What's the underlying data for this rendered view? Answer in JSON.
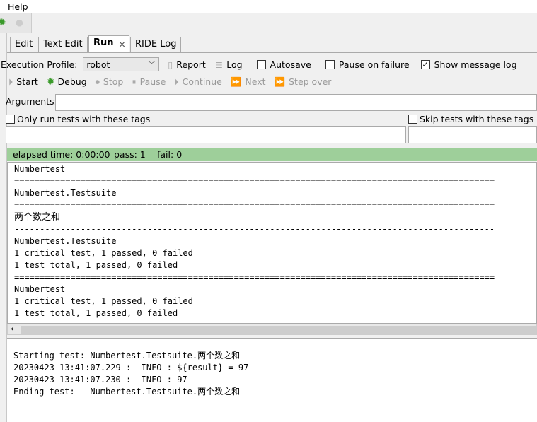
{
  "menu": {
    "help": "Help"
  },
  "tabs": [
    "Edit",
    "Text Edit",
    "Run",
    "RIDE Log"
  ],
  "tab_close": "×",
  "profile": {
    "label": "Execution Profile:",
    "value": "robot",
    "report": "Report",
    "log": "Log",
    "autosave": "Autosave",
    "pause_on_failure": "Pause on failure",
    "show_message_log": "Show message log",
    "autosave_checked": false,
    "pause_checked": false,
    "show_log_checked": true
  },
  "controls": {
    "start": "Start",
    "debug": "Debug",
    "stop": "Stop",
    "pause": "Pause",
    "continue": "Continue",
    "next": "Next",
    "step_over": "Step over"
  },
  "arguments": {
    "label": "Arguments:",
    "value": ""
  },
  "tags": {
    "only_run": "Only run tests with these tags",
    "skip": "Skip tests with these tags",
    "include_value": "",
    "exclude_value": ""
  },
  "status": {
    "elapsed": "elapsed time: 0:00:00",
    "pass": "pass: 1",
    "fail": "fail: 0"
  },
  "output": [
    "Numbertest",
    "==============================================================================================",
    "Numbertest.Testsuite",
    "==============================================================================================",
    "两个数之和",
    "----------------------------------------------------------------------------------------------",
    "Numbertest.Testsuite",
    "1 critical test, 1 passed, 0 failed",
    "1 test total, 1 passed, 0 failed",
    "==============================================================================================",
    "Numbertest",
    "1 critical test, 1 passed, 0 failed",
    "1 test total, 1 passed, 0 failed"
  ],
  "message_log": [
    "Starting test: Numbertest.Testsuite.两个数之和",
    "20230423 13:41:07.229 :  INFO : ${result} = 97",
    "20230423 13:41:07.230 :  INFO : 97",
    "Ending test:   Numbertest.Testsuite.两个数之和"
  ]
}
